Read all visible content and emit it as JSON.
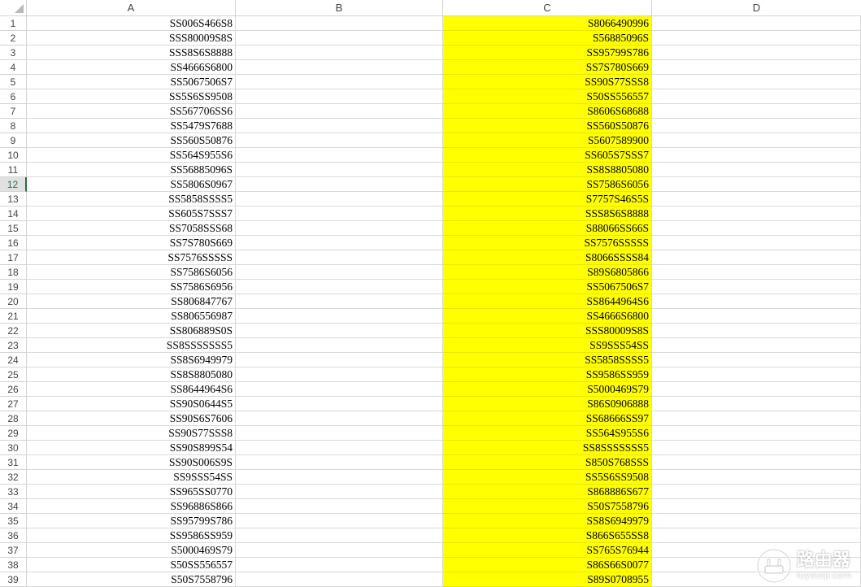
{
  "sheet": {
    "columns": [
      "A",
      "B",
      "C",
      "D"
    ],
    "active_row": 12,
    "highlight_color": "#ffff00",
    "rows": [
      {
        "num": "1",
        "a": "SS006S466S8",
        "c": "S8066490996"
      },
      {
        "num": "2",
        "a": "SSS80009S8S",
        "c": "S56885096S"
      },
      {
        "num": "3",
        "a": "SSS8S6S8888",
        "c": "SS95799S786"
      },
      {
        "num": "4",
        "a": "SS4666S6800",
        "c": "SS7S780S669"
      },
      {
        "num": "5",
        "a": "SS5067506S7",
        "c": "SS90S77SSS8"
      },
      {
        "num": "6",
        "a": "SS5S6SS9508",
        "c": "S50SS556557"
      },
      {
        "num": "7",
        "a": "SS567706SS6",
        "c": "S8606S68688"
      },
      {
        "num": "8",
        "a": "SS5479S7688",
        "c": "SS560S50876"
      },
      {
        "num": "9",
        "a": "SS560S50876",
        "c": "S5607589900"
      },
      {
        "num": "10",
        "a": "SS564S955S6",
        "c": "SS605S7SSS7"
      },
      {
        "num": "11",
        "a": "SS56885096S",
        "c": "SS8S8805080"
      },
      {
        "num": "12",
        "a": "SS5806S0967",
        "c": "SS7586S6056"
      },
      {
        "num": "13",
        "a": "SS5858SSSS5",
        "c": "S7757S46S5S"
      },
      {
        "num": "14",
        "a": "SS605S7SSS7",
        "c": "SSS8S6S8888"
      },
      {
        "num": "15",
        "a": "SS7058SSS68",
        "c": "S88066SS66S"
      },
      {
        "num": "16",
        "a": "SS7S780S669",
        "c": "SS7576SSSSS"
      },
      {
        "num": "17",
        "a": "SS7576SSSSS",
        "c": "S8066SSSS84"
      },
      {
        "num": "18",
        "a": "SS7586S6056",
        "c": "S89S6805866"
      },
      {
        "num": "19",
        "a": "SS7586S6956",
        "c": "SS5067506S7"
      },
      {
        "num": "20",
        "a": "SS806847767",
        "c": "SS8644964S6"
      },
      {
        "num": "21",
        "a": "SS806556987",
        "c": "SS4666S6800"
      },
      {
        "num": "22",
        "a": "SS806889S0S",
        "c": "SSS80009S8S"
      },
      {
        "num": "23",
        "a": "SS8SSSSSSS5",
        "c": "SS9SSS54SS"
      },
      {
        "num": "24",
        "a": "SS8S6949979",
        "c": "SS5858SSSS5"
      },
      {
        "num": "25",
        "a": "SS8S8805080",
        "c": "SS9586SS959"
      },
      {
        "num": "26",
        "a": "SS8644964S6",
        "c": "S5000469S79"
      },
      {
        "num": "27",
        "a": "SS90S0644S5",
        "c": "S86S0906888"
      },
      {
        "num": "28",
        "a": "SS90S6S7606",
        "c": "SS68666SS97"
      },
      {
        "num": "29",
        "a": "SS90S77SSS8",
        "c": "SS564S955S6"
      },
      {
        "num": "30",
        "a": "SS90S899S54",
        "c": "SS8SSSSSSS5"
      },
      {
        "num": "31",
        "a": "SS90S006S9S",
        "c": "S850S768SSS"
      },
      {
        "num": "32",
        "a": "SS9SSS54SS",
        "c": "SS5S6SS9508"
      },
      {
        "num": "33",
        "a": "SS965SS0770",
        "c": "S868886S677"
      },
      {
        "num": "34",
        "a": "SS96886S866",
        "c": "S50S7558796"
      },
      {
        "num": "35",
        "a": "SS95799S786",
        "c": "SS8S6949979"
      },
      {
        "num": "36",
        "a": "SS9586SS959",
        "c": "S866S655SS8"
      },
      {
        "num": "37",
        "a": "S5000469S79",
        "c": "SS765S76944"
      },
      {
        "num": "38",
        "a": "S50SS556557",
        "c": "S86S66S0077"
      },
      {
        "num": "39",
        "a": "S50S7558796",
        "c": "S89S0708955"
      }
    ]
  },
  "watermark": {
    "main": "路由器",
    "sub": "luyouqi.com",
    "icon": "router-logo-icon"
  }
}
